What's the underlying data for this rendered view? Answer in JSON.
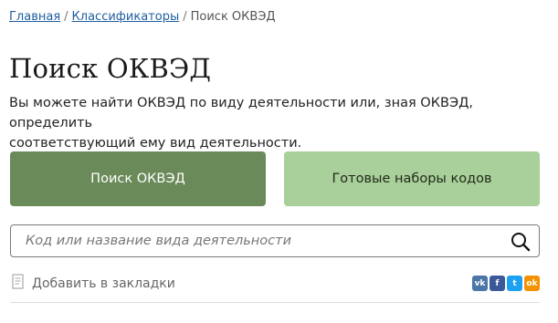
{
  "breadcrumb": {
    "items": [
      {
        "label": "Главная",
        "link": true
      },
      {
        "label": "Классификаторы",
        "link": true
      },
      {
        "label": "Поиск ОКВЭД",
        "link": false
      }
    ],
    "separator": "/"
  },
  "page": {
    "title": "Поиск ОКВЭД",
    "description_line1": "Вы можете найти ОКВЭД по виду деятельности или, зная ОКВЭД, определить",
    "description_line2": "соответствующий ему вид деятельности."
  },
  "tabs": {
    "search_label": "Поиск ОКВЭД",
    "sets_label": "Готовые наборы кодов"
  },
  "search": {
    "value": "",
    "placeholder": "Код или название вида деятельности"
  },
  "bookmark": {
    "label": "Добавить в закладки"
  },
  "share": [
    {
      "name": "vk",
      "glyph": "vk",
      "color": "#4a76a8"
    },
    {
      "name": "facebook",
      "glyph": "f",
      "color": "#3b5998"
    },
    {
      "name": "twitter",
      "glyph": "t",
      "color": "#1da1f2"
    },
    {
      "name": "odnoklassniki",
      "glyph": "ok",
      "color": "#f39200"
    }
  ],
  "colors": {
    "primary_button": "#6b8a5a",
    "secondary_button": "#a9cf9a",
    "link": "#1f5fa0"
  }
}
